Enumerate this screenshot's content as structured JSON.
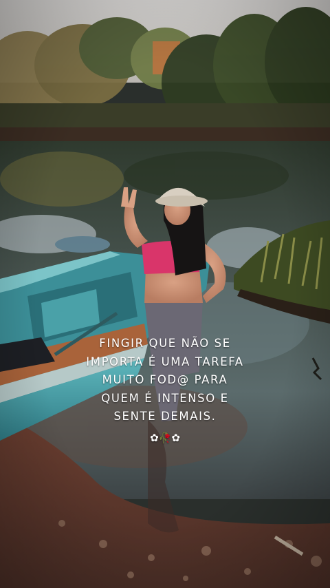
{
  "caption": {
    "lines": [
      "FINGIR QUE NÃO SE",
      "IMPORTA É UMA TAREFA",
      "MUITO FOD@ PARA",
      "QUEM É INTENSO E",
      "SENTE DEMAIS."
    ],
    "emoji": "✿🥀✿"
  },
  "colors": {
    "sky": "#c9c8c6",
    "foliage": "#3f4a2c",
    "water": "#3a4640",
    "mud": "#5a3a2e",
    "boat": "#4fa6ad",
    "top": "#d9356a",
    "pants": "#6b6874"
  },
  "icons": [
    "flower-icon",
    "rose-icon"
  ]
}
